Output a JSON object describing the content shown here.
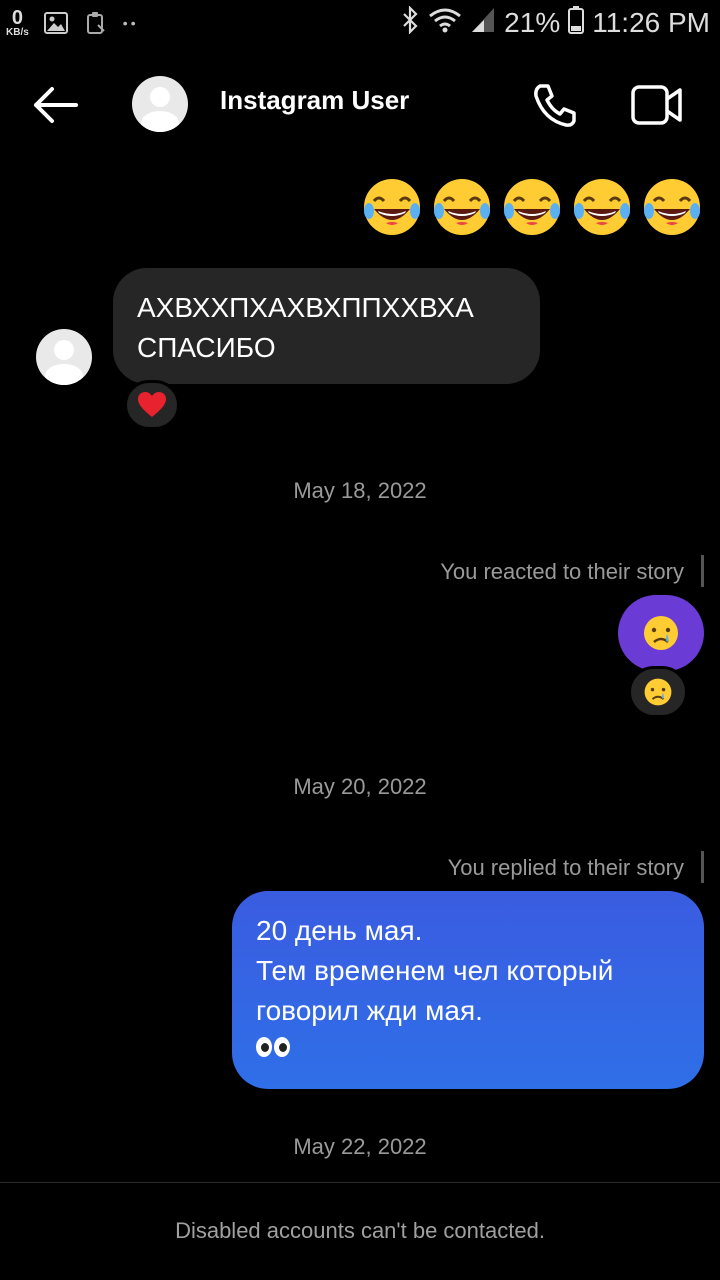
{
  "status_bar": {
    "speed_value": "0",
    "speed_unit": "KB/s",
    "battery_percent": "21%",
    "time": "11:26 PM"
  },
  "header": {
    "contact_name": "Instagram User"
  },
  "messages": {
    "sent_emojis": [
      "laughing-tears",
      "laughing-tears",
      "laughing-tears",
      "laughing-tears",
      "laughing-tears"
    ],
    "received_lines": [
      "АХВХХПХАХВХППХХВХА",
      "СПАСИБО"
    ],
    "received_reaction": "red-heart",
    "date_1": "May 18, 2022",
    "story_reaction_label": "You reacted to their story",
    "story_reaction_emoji": "crying-face",
    "date_2": "May 20, 2022",
    "story_reply_label": "You replied to their story",
    "reply_lines": [
      "20 день мая.",
      "Тем временем чел который",
      "говорил жди мая."
    ],
    "reply_emoji": "eyes",
    "date_3": "May 22, 2022"
  },
  "footer": {
    "notice": "Disabled accounts can't be contacted."
  },
  "colors": {
    "background": "#000000",
    "incoming_bubble": "#262626",
    "outgoing_bubble": "#3a5ce0",
    "story_circle": "#6b3bd6"
  }
}
